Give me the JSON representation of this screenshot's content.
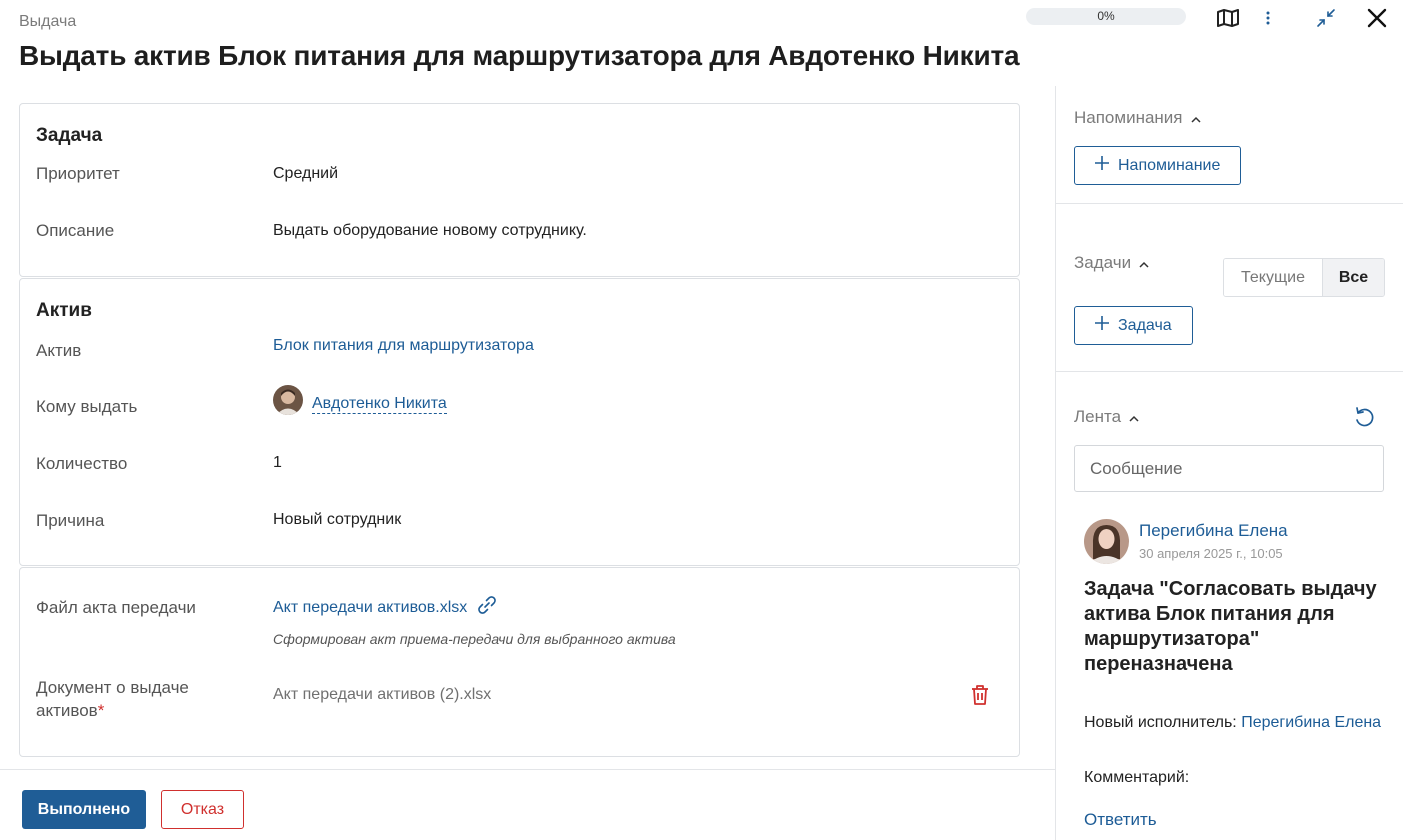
{
  "header": {
    "breadcrumb": "Выдача",
    "title": "Выдать актив Блок питания для маршрутизатора для Авдотенко Никита",
    "progress_text": "0%",
    "progress_value": 0,
    "icons": [
      "map-icon",
      "more-vertical-icon",
      "collapse-icon",
      "close-icon"
    ]
  },
  "task": {
    "title": "Задача",
    "priority_label": "Приоритет",
    "priority_value": "Средний",
    "description_label": "Описание",
    "description_value": "Выдать оборудование новому сотруднику."
  },
  "asset": {
    "title": "Актив",
    "asset_label": "Актив",
    "asset_value": "Блок питания для маршрутизатора",
    "recipient_label": "Кому выдать",
    "recipient_value": "Авдотенко Никита",
    "quantity_label": "Количество",
    "quantity_value": "1",
    "reason_label": "Причина",
    "reason_value": "Новый сотрудник"
  },
  "files": {
    "act_label": "Файл акта передачи",
    "act_value": "Акт передачи активов.xlsx",
    "act_note": "Сформирован акт приема-передачи для выбранного актива",
    "doc_label": "Документ о выдаче активов",
    "doc_required": "*",
    "doc_value": "Акт передачи активов (2).xlsx"
  },
  "footer": {
    "done_label": "Выполнено",
    "reject_label": "Отказ"
  },
  "sidebar": {
    "reminders_title": "Напоминания",
    "add_reminder_label": "Напоминание",
    "tasks_title": "Задачи",
    "tab_current": "Текущие",
    "tab_all": "Все",
    "add_task_label": "Задача",
    "feed_title": "Лента",
    "message_placeholder": "Сообщение",
    "feed_item": {
      "author": "Перегибина Елена",
      "time": "30 апреля 2025 г., 10:05",
      "headline": "Задача \"Согласовать выдачу актива Блок питания для маршрутизатора\" переназначена",
      "new_executor_label": "Новый исполнитель:",
      "new_executor_value": "Перегибина Елена",
      "comment_label": "Комментарий:",
      "reply_label": "Ответить"
    }
  },
  "colors": {
    "accent": "#1f5d96",
    "link": "#1d5c96",
    "danger": "#d0302e",
    "border": "#dcdfe3"
  }
}
